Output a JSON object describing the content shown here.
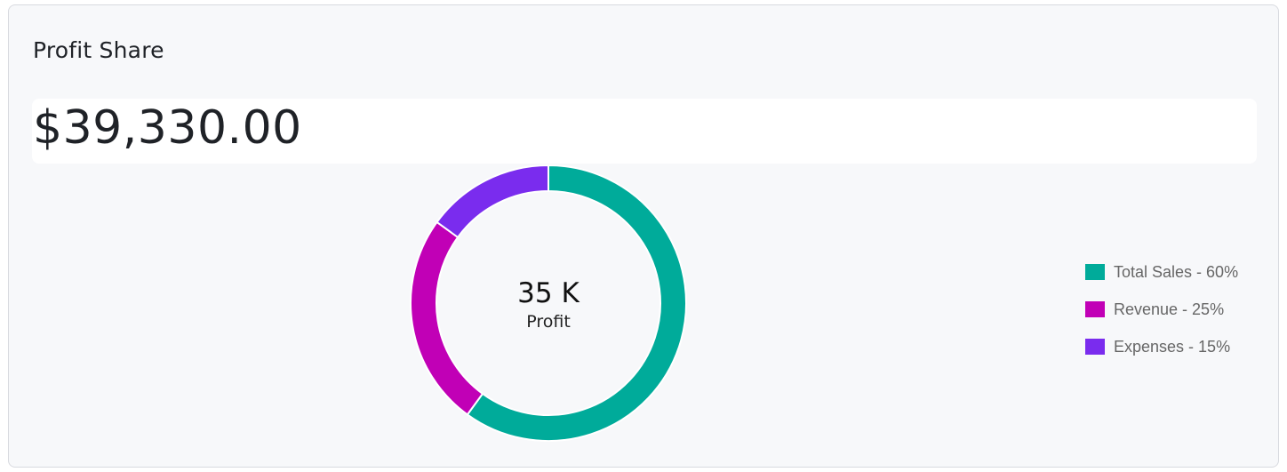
{
  "card": {
    "title": "Profit Share",
    "amount": "$39,330.00"
  },
  "chart_data": {
    "type": "pie",
    "categories": [
      "Total Sales",
      "Revenue",
      "Expenses"
    ],
    "values": [
      60,
      25,
      15
    ],
    "center_value": "35 K",
    "center_label": "Profit",
    "legend_labels": [
      "Total Sales - 60%",
      "Revenue - 25%",
      "Expenses - 15%"
    ],
    "colors": [
      "#00ab9a",
      "#c100b6",
      "#7a2cee"
    ],
    "legend_position": "right"
  }
}
